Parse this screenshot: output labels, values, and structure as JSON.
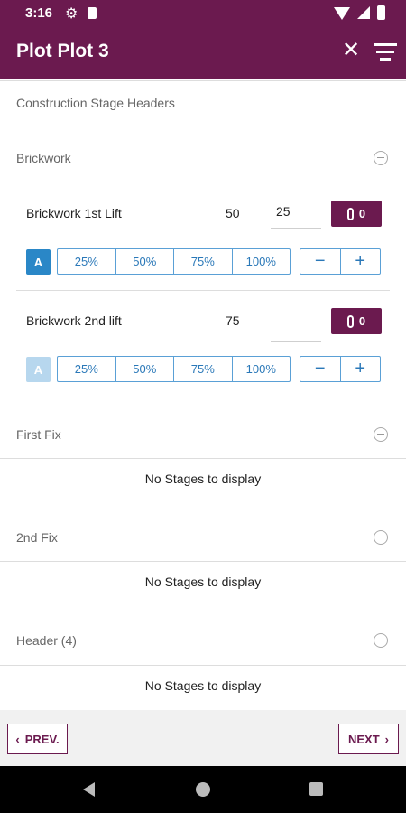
{
  "status_bar": {
    "time": "3:16"
  },
  "app_bar": {
    "title": "Plot Plot 3",
    "close_icon": "close-icon",
    "filter_icon": "filter-icon"
  },
  "page_heading": "Construction Stage Headers",
  "sections": {
    "brickwork": {
      "label": "Brickwork",
      "stages": [
        {
          "name": "Brickwork 1st Lift",
          "value": "50",
          "input": "25",
          "attachments": "0",
          "a_label": "A",
          "a_active": true
        },
        {
          "name": "Brickwork 2nd lift",
          "value": "75",
          "input": "",
          "attachments": "0",
          "a_label": "A",
          "a_active": false
        }
      ]
    },
    "first_fix": {
      "label": "First Fix",
      "empty": "No Stages to display"
    },
    "second_fix": {
      "label": "2nd Fix",
      "empty": "No Stages to display"
    },
    "header4": {
      "label": "Header (4)",
      "empty": "No Stages to display"
    }
  },
  "percent_buttons": [
    "25%",
    "50%",
    "75%",
    "100%"
  ],
  "stepper": {
    "minus": "−",
    "plus": "+"
  },
  "footer": {
    "prev_label": "PREV.",
    "next_label": "NEXT"
  },
  "colors": {
    "primary": "#6b1a4f",
    "accent_blue": "#2a87c7"
  }
}
